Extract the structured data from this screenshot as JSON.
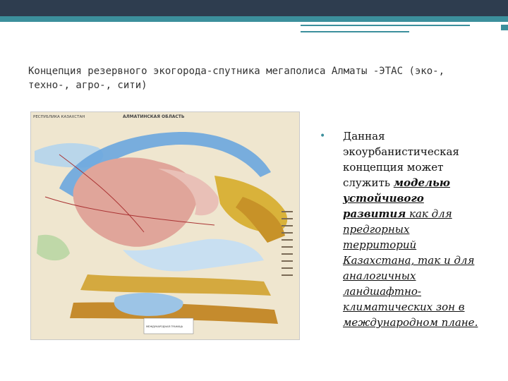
{
  "header": {
    "band_color": "#2e3d4f",
    "accent_color": "#3c8f9c"
  },
  "slide": {
    "title": "Концепция резервного экогорода-спутника мегаполиса Алматы -ЭТАС (эко-, техно-, агро-, сити)"
  },
  "map": {
    "left_title": "РЕСПУБЛИКА КАЗАХСТАН",
    "center_title": "АЛМАТИНСКАЯ ОБЛАСТЬ",
    "legend_label": "МЕЖДУНАРОДНАЯ ГРАНИЦА"
  },
  "bullet": {
    "part1": "Данная экоурбанистическая концепция может служить ",
    "emph": "моделью устойчивого развития",
    "part2": " как для предгорных территорий Казахстана, так и для аналогичных ландшафтно-климатических зон в международном плане."
  }
}
